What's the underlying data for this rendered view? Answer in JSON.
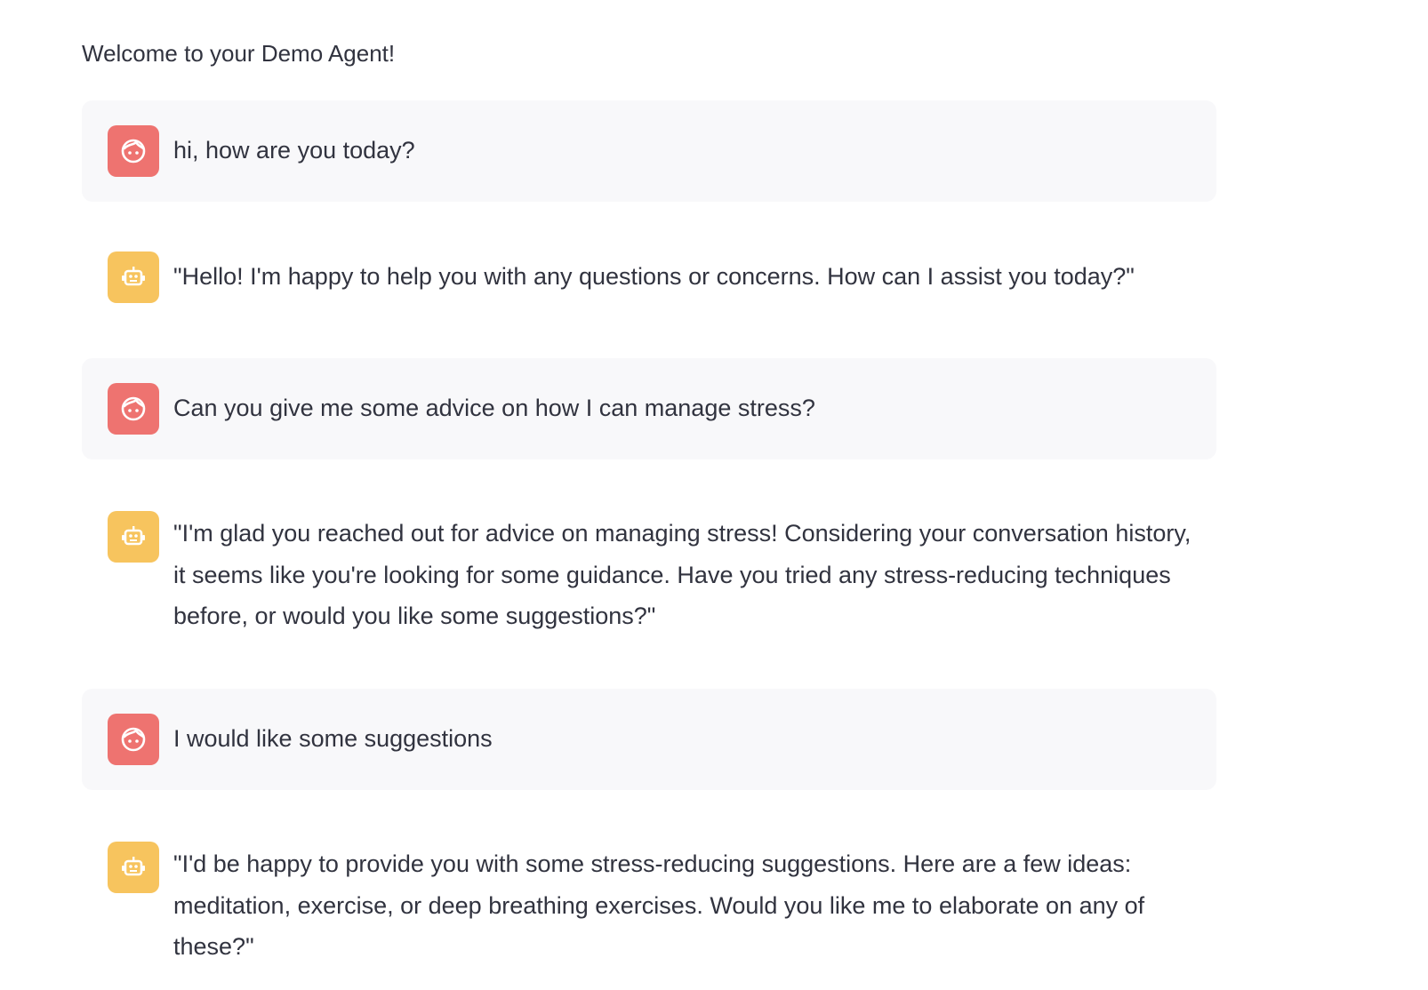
{
  "welcome": "Welcome to your Demo Agent!",
  "colors": {
    "user_avatar": "#ee7370",
    "bot_avatar": "#f7c45e",
    "user_bubble": "#f8f8fa",
    "text": "#31333f"
  },
  "messages": [
    {
      "role": "user",
      "icon": "user-face-icon",
      "text": "hi, how are you today?"
    },
    {
      "role": "assistant",
      "icon": "robot-icon",
      "text": "\"Hello! I'm happy to help you with any questions or concerns. How can I assist you today?\""
    },
    {
      "role": "user",
      "icon": "user-face-icon",
      "text": "Can you give me some advice on how I can manage stress?"
    },
    {
      "role": "assistant",
      "icon": "robot-icon",
      "text": "\"I'm glad you reached out for advice on managing stress! Considering your conversation history, it seems like you're looking for some guidance. Have you tried any stress-reducing techniques before, or would you like some suggestions?\""
    },
    {
      "role": "user",
      "icon": "user-face-icon",
      "text": "I would like some suggestions"
    },
    {
      "role": "assistant",
      "icon": "robot-icon",
      "text": "\"I'd be happy to provide you with some stress-reducing suggestions. Here are a few ideas: meditation, exercise, or deep breathing exercises. Would you like me to elaborate on any of these?\""
    }
  ]
}
